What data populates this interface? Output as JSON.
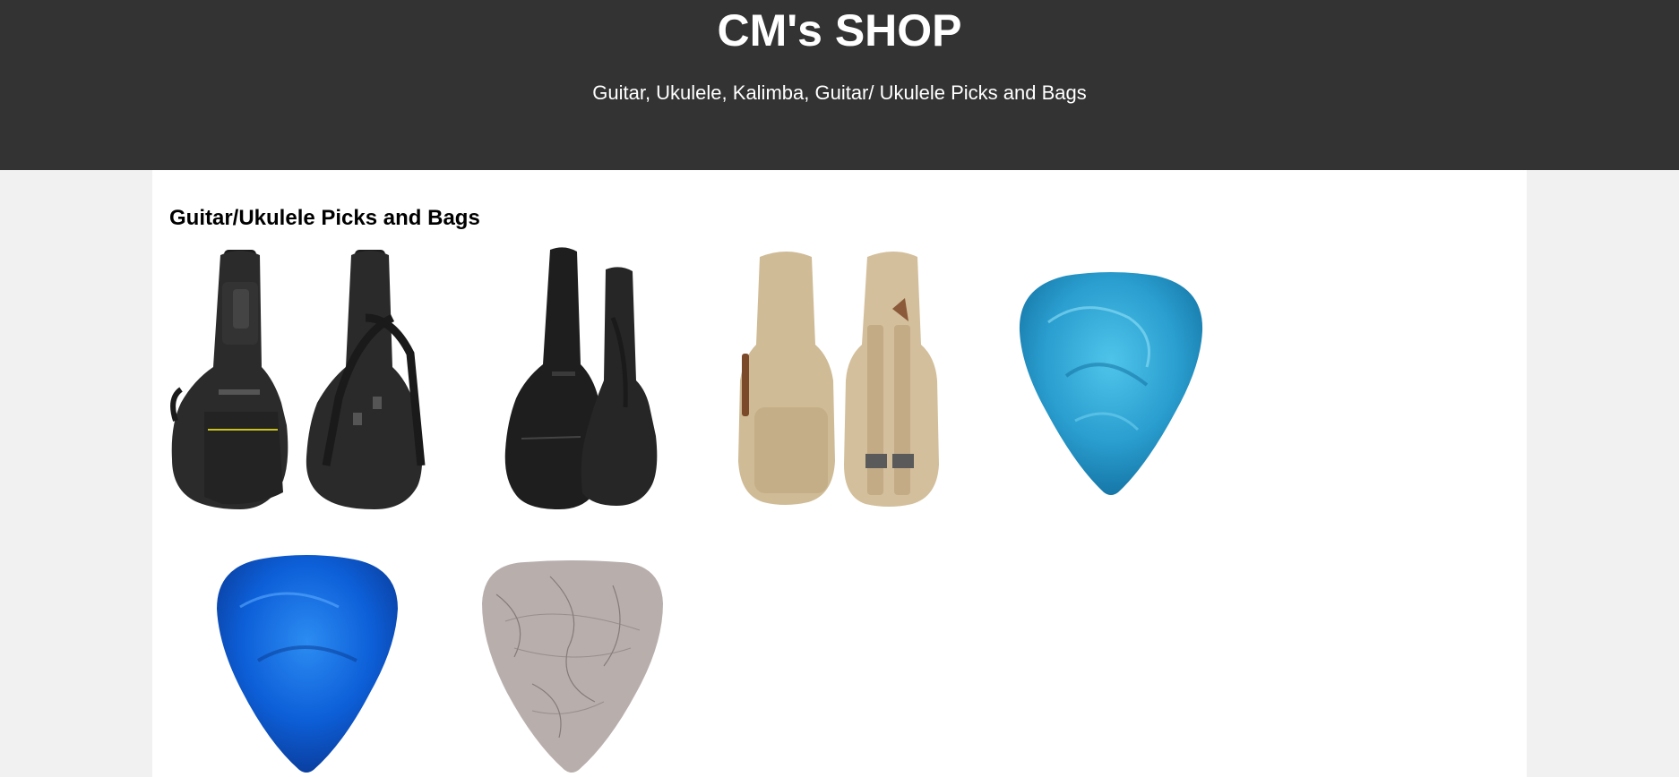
{
  "header": {
    "title": "CM's SHOP",
    "subtitle": "Guitar, Ukulele, Kalimba, Guitar/ Ukulele Picks and Bags"
  },
  "section": {
    "title": "Guitar/Ukulele Picks and Bags"
  },
  "products": [
    {
      "name": "black-padded-guitar-bag",
      "color": "#2a2a2a"
    },
    {
      "name": "black-thin-guitar-bag",
      "color": "#1d1d1d"
    },
    {
      "name": "khaki-ukulele-bag",
      "color": "#cdb894"
    },
    {
      "name": "teal-pearl-pick",
      "color": "#2a9fd0"
    },
    {
      "name": "blue-pearl-pick",
      "color": "#0d5fd8"
    },
    {
      "name": "felt-gray-pick",
      "color": "#b8afad"
    }
  ],
  "colors": {
    "header_bg": "#333333",
    "page_bg": "#f1f1f1",
    "content_bg": "#ffffff"
  }
}
